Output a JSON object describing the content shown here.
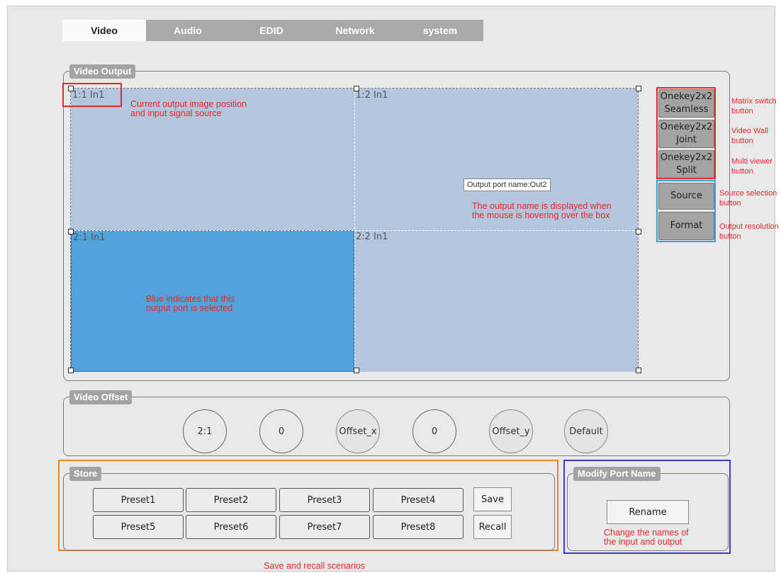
{
  "tabs": [
    "Video",
    "Audio",
    "EDID",
    "Network",
    "system"
  ],
  "video_output": {
    "legend": "Video Output",
    "cells": [
      "1:1 In1",
      "1:2 In1",
      "2:1 In1",
      "2:2 In1"
    ],
    "tooltip": "Output port name:Out2",
    "side_buttons": [
      {
        "line1": "Onekey2x2",
        "line2": "Seamless"
      },
      {
        "line1": "Onekey2x2",
        "line2": "Joint"
      },
      {
        "line1": "Onekey2x2",
        "line2": "Split"
      },
      {
        "line1": "Source",
        "line2": ""
      },
      {
        "line1": "Format",
        "line2": ""
      }
    ]
  },
  "video_offset": {
    "legend": "Video Offset",
    "controls": [
      "2:1",
      "0",
      "Offset_x",
      "0",
      "Offset_y",
      "Default"
    ]
  },
  "store": {
    "legend": "Store",
    "presets": [
      "Preset1",
      "Preset2",
      "Preset3",
      "Preset4",
      "Preset5",
      "Preset6",
      "Preset7",
      "Preset8"
    ],
    "save": "Save",
    "recall": "Recall"
  },
  "modify_port": {
    "legend": "Modify Port Name",
    "rename": "Rename"
  },
  "annotations": {
    "position": [
      "Current output image position",
      "and input signal source"
    ],
    "hover": [
      "The output name is displayed when",
      "the mouse is hovering over the box"
    ],
    "selected": [
      "Blue indicates that this",
      "output port is selected"
    ],
    "matrix": [
      "Matrix switch",
      "button"
    ],
    "wall": [
      "Video Wall",
      "button"
    ],
    "multiviewer": [
      "Multi viewer",
      "button"
    ],
    "source": [
      "Source selection",
      "button"
    ],
    "resolution": [
      "Output resolution",
      "button"
    ],
    "rename": [
      "Change the names of",
      "the input and output"
    ],
    "save_recall": "Save and recall scenarios"
  },
  "colors": {
    "cell": "#b4c6de",
    "selected_cell": "#52a2dc",
    "annotation_red": "#e8262a",
    "annotation_blue": "#2aa7e0",
    "annotation_orange": "#f0851e",
    "annotation_purple": "#3b3bd0"
  }
}
